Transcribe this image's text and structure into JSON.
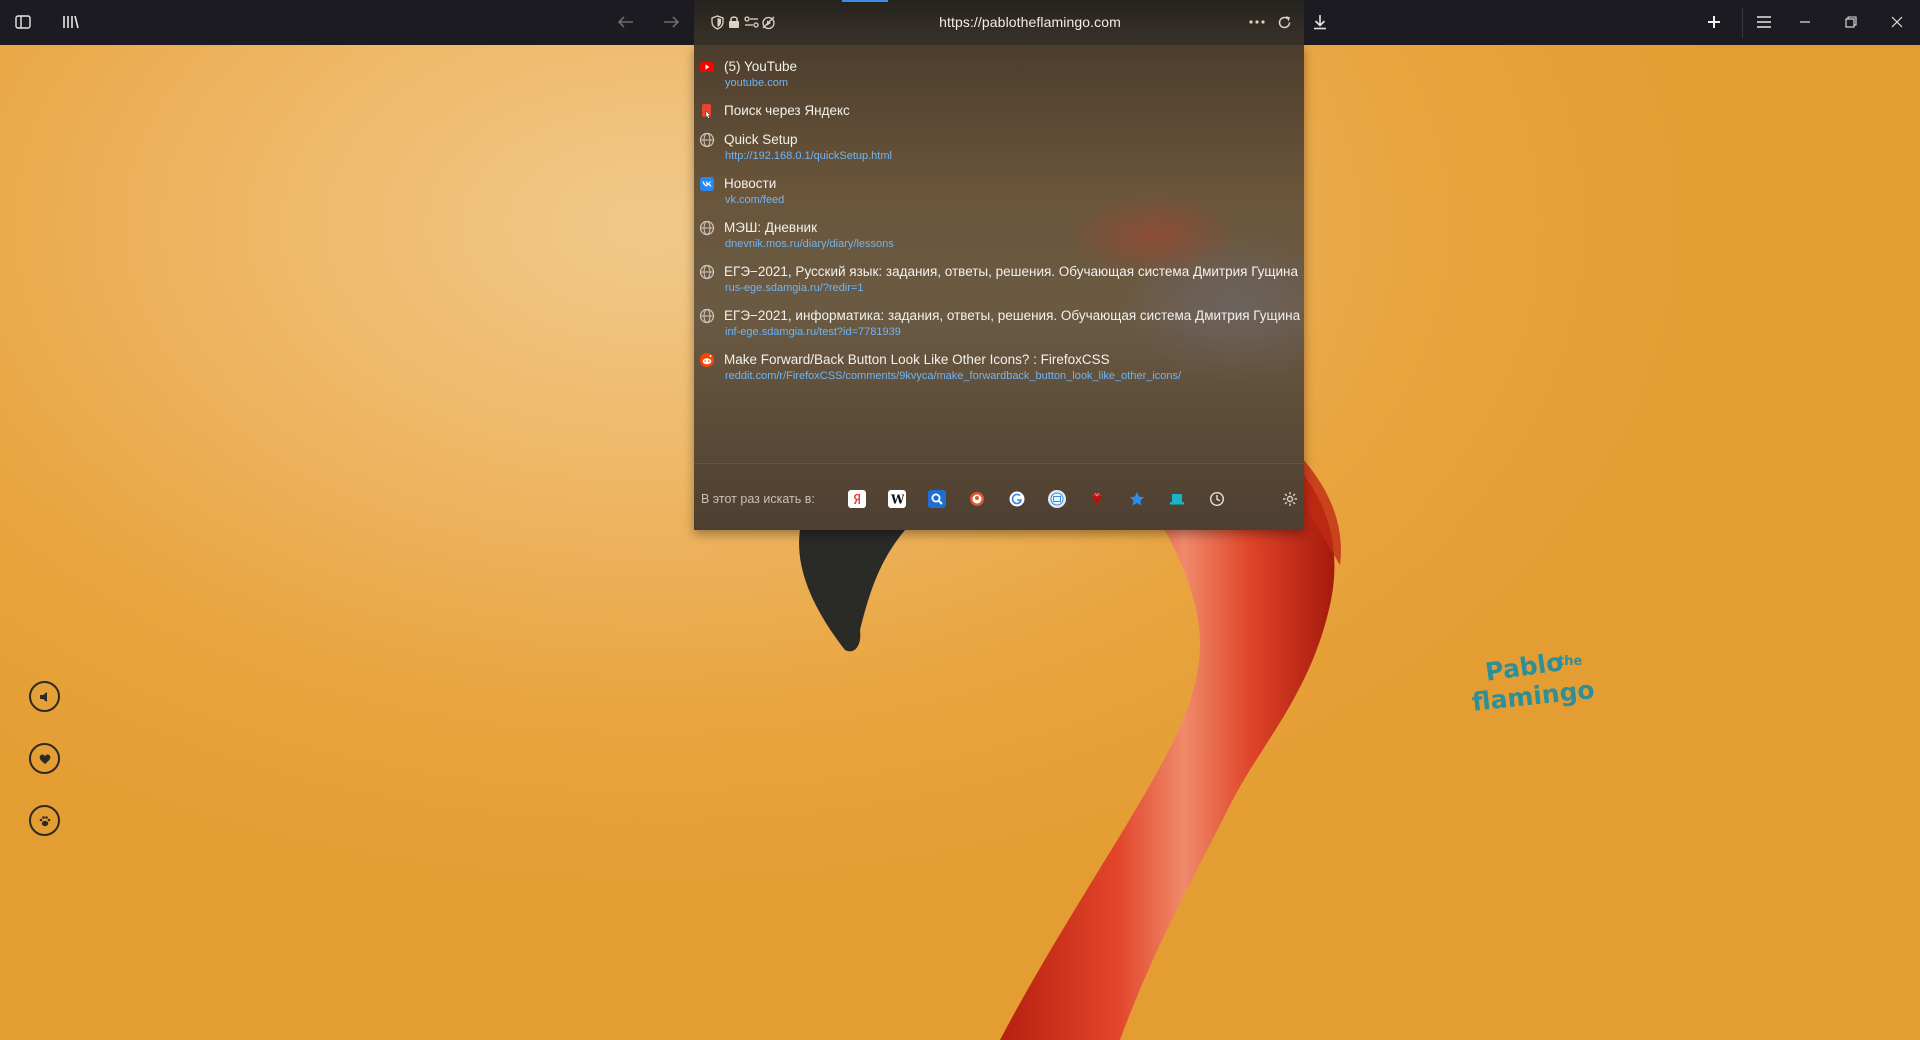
{
  "toolbar": {
    "url": "https://pablotheflamingo.com",
    "icons": [
      "sidebar-icon",
      "library-icon",
      "back-icon",
      "forward-icon",
      "shield-icon",
      "lock-icon",
      "permissions-icon",
      "autoplay-icon",
      "page-actions-icon",
      "reload-icon",
      "downloads-icon",
      "new-tab-icon",
      "menu-icon",
      "minimize-icon",
      "restore-icon",
      "close-icon"
    ]
  },
  "dropdown": {
    "results": [
      {
        "title": "(5) YouTube",
        "url": "youtube.com",
        "icon": "youtube-icon"
      },
      {
        "title": "Поиск через Яндекс",
        "url": "",
        "icon": "yandex-icon"
      },
      {
        "title": "Quick Setup",
        "url": "http://192.168.0.1/quickSetup.html",
        "icon": "globe-icon"
      },
      {
        "title": "Новости",
        "url": "vk.com/feed",
        "icon": "vk-icon"
      },
      {
        "title": "МЭШ: Дневник",
        "url": "dnevnik.mos.ru/diary/diary/lessons",
        "icon": "globe-icon"
      },
      {
        "title": "ЕГЭ−2021, Русский язык: задания, ответы, решения. Обучающая система Дмитрия Гущина",
        "url": "rus-ege.sdamgia.ru/?redir=1",
        "icon": "globe-icon"
      },
      {
        "title": "ЕГЭ−2021, информатика: задания, ответы, решения. Обучающая система Дмитрия Гущина",
        "url": "inf-ege.sdamgia.ru/test?id=7781939",
        "icon": "globe-icon"
      },
      {
        "title": "Make Forward/Back Button Look Like Other Icons? : FirefoxCSS",
        "url": "reddit.com/r/FirefoxCSS/comments/9kvyca/make_forwardback_button_look_like_other_icons/",
        "icon": "reddit-icon"
      }
    ],
    "oneoff_label": "В этот раз искать в:",
    "engines": [
      "yandex-engine-icon",
      "wikipedia-engine-icon",
      "search-engine-icon",
      "duckduckgo-engine-icon",
      "google-engine-icon",
      "mail-engine-icon",
      "ruby-engine-icon",
      "bookmarks-star-icon",
      "tabs-icon",
      "history-icon",
      "search-settings-icon"
    ]
  },
  "page": {
    "logo_line1": "Pablo",
    "logo_small": "the",
    "logo_line2": "flamingo",
    "side_buttons": [
      "sound-icon",
      "heart-icon",
      "paw-icon"
    ]
  },
  "colors": {
    "toolbar": "#1c1b22",
    "background": "#e9a43f",
    "link": "#6eb6f5",
    "logo": "#2f8f98",
    "flamingo": "#d83a20"
  }
}
